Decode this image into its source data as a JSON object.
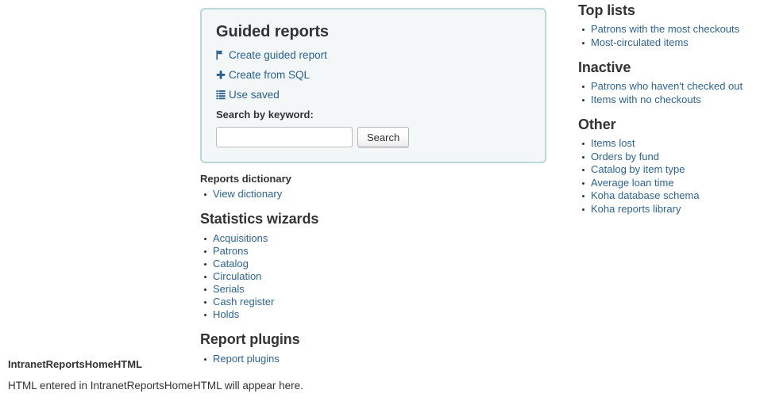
{
  "colors": {
    "link": "#2c6496",
    "heading": "#333333",
    "panel_border": "#b9d8d9",
    "panel_bg": "#f3f7f8"
  },
  "guided_reports_panel": {
    "title": "Guided reports",
    "links": [
      {
        "icon": "magic-wand-icon",
        "label": "Create guided report"
      },
      {
        "icon": "plus-icon",
        "label": "Create from SQL"
      },
      {
        "icon": "list-icon",
        "label": "Use saved"
      }
    ],
    "search": {
      "label": "Search by keyword:",
      "value": "",
      "placeholder": "",
      "button_label": "Search"
    }
  },
  "reports_dictionary": {
    "title": "Reports dictionary",
    "items": [
      {
        "label": "View dictionary"
      }
    ]
  },
  "statistics_wizards": {
    "title": "Statistics wizards",
    "items": [
      {
        "label": "Acquisitions"
      },
      {
        "label": "Patrons"
      },
      {
        "label": "Catalog"
      },
      {
        "label": "Circulation"
      },
      {
        "label": "Serials"
      },
      {
        "label": "Cash register"
      },
      {
        "label": "Holds"
      }
    ]
  },
  "report_plugins": {
    "title": "Report plugins",
    "items": [
      {
        "label": "Report plugins"
      }
    ]
  },
  "sidebar": {
    "groups": [
      {
        "title": "Top lists",
        "items": [
          {
            "label": "Patrons with the most checkouts"
          },
          {
            "label": "Most-circulated items"
          }
        ]
      },
      {
        "title": "Inactive",
        "items": [
          {
            "label": "Patrons who haven't checked out"
          },
          {
            "label": "Items with no checkouts"
          }
        ]
      },
      {
        "title": "Other",
        "items": [
          {
            "label": "Items lost"
          },
          {
            "label": "Orders by fund"
          },
          {
            "label": "Catalog by item type"
          },
          {
            "label": "Average loan time"
          },
          {
            "label": "Koha database schema"
          },
          {
            "label": "Koha reports library"
          }
        ]
      }
    ]
  },
  "bottom_block": {
    "title": "IntranetReportsHomeHTML",
    "text": "HTML entered in IntranetReportsHomeHTML will appear here."
  }
}
